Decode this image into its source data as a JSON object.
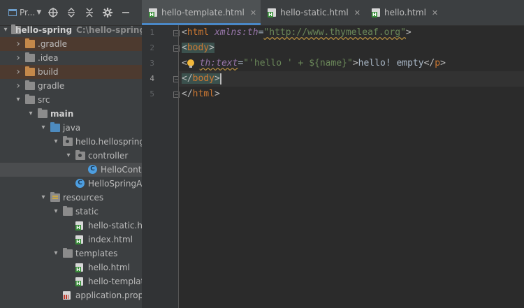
{
  "project_panel": {
    "view_label": "Pr...",
    "toolbar_icons": [
      "locate-icon",
      "expand-all-icon",
      "collapse-all-icon",
      "gear-icon",
      "hide-icon"
    ],
    "root": {
      "name": "hello-spring",
      "path": "C:\\hello-spring\\he"
    },
    "items": [
      {
        "label": ".gradle",
        "kind": "folder-orange",
        "depth": 1,
        "arrow": "closed",
        "excluded": true
      },
      {
        "label": ".idea",
        "kind": "folder",
        "depth": 1,
        "arrow": "closed"
      },
      {
        "label": "build",
        "kind": "folder-orange",
        "depth": 1,
        "arrow": "closed",
        "excluded": true
      },
      {
        "label": "gradle",
        "kind": "folder",
        "depth": 1,
        "arrow": "closed"
      },
      {
        "label": "src",
        "kind": "folder",
        "depth": 1,
        "arrow": "open"
      },
      {
        "label": "main",
        "kind": "folder",
        "depth": 2,
        "arrow": "open",
        "bold": true
      },
      {
        "label": "java",
        "kind": "folder-blue",
        "depth": 3,
        "arrow": "open"
      },
      {
        "label": "hello.hellospring",
        "kind": "package",
        "depth": 4,
        "arrow": "open"
      },
      {
        "label": "controller",
        "kind": "package",
        "depth": 5,
        "arrow": "open"
      },
      {
        "label": "HelloControlle",
        "kind": "class",
        "depth": 6,
        "selected": true
      },
      {
        "label": "HelloSpringAppli",
        "kind": "class",
        "depth": 5
      },
      {
        "label": "resources",
        "kind": "resources",
        "depth": 3,
        "arrow": "open"
      },
      {
        "label": "static",
        "kind": "folder",
        "depth": 4,
        "arrow": "open"
      },
      {
        "label": "hello-static.html",
        "kind": "html",
        "depth": 5
      },
      {
        "label": "index.html",
        "kind": "html",
        "depth": 5
      },
      {
        "label": "templates",
        "kind": "folder",
        "depth": 4,
        "arrow": "open"
      },
      {
        "label": "hello.html",
        "kind": "html",
        "depth": 5
      },
      {
        "label": "hello-template.ht",
        "kind": "html",
        "depth": 5
      },
      {
        "label": "application.propertie",
        "kind": "properties",
        "depth": 4
      }
    ]
  },
  "tabs": [
    {
      "label": "hello-template.html",
      "active": true
    },
    {
      "label": "hello-static.html",
      "active": false
    },
    {
      "label": "hello.html",
      "active": false
    }
  ],
  "editor": {
    "line_numbers": [
      "1",
      "2",
      "3",
      "4",
      "5"
    ],
    "current_line": 4,
    "lines": [
      [
        {
          "t": "<",
          "c": "bracket"
        },
        {
          "t": "html",
          "c": "tn"
        },
        {
          "t": " ",
          "c": "plain"
        },
        {
          "t": "xmlns:th",
          "c": "attr-ns"
        },
        {
          "t": "=",
          "c": "plain"
        },
        {
          "t": "\"http://www.thymeleaf.org\"",
          "c": "str wavy"
        },
        {
          "t": ">",
          "c": "bracket"
        }
      ],
      [
        {
          "t": "<",
          "c": "bracket hl-tag"
        },
        {
          "t": "body",
          "c": "tn hl-tag"
        },
        {
          "t": ">",
          "c": "bracket hl-tag"
        }
      ],
      [
        {
          "t": "<",
          "c": "bracket"
        },
        {
          "t": "BULB",
          "c": "bulb"
        },
        {
          "t": " ",
          "c": "plain"
        },
        {
          "t": "th:text",
          "c": "attr-ns wavy"
        },
        {
          "t": "=",
          "c": "plain"
        },
        {
          "t": "\"'hello ' + ${name}\"",
          "c": "str"
        },
        {
          "t": ">",
          "c": "bracket"
        },
        {
          "t": "hello! empty",
          "c": "plain"
        },
        {
          "t": "</",
          "c": "bracket"
        },
        {
          "t": "p",
          "c": "tn"
        },
        {
          "t": ">",
          "c": "bracket"
        }
      ],
      [
        {
          "t": "</",
          "c": "bracket hl-tag"
        },
        {
          "t": "body",
          "c": "tn hl-tag"
        },
        {
          "t": ">",
          "c": "bracket hl-tag"
        },
        {
          "t": "CARET",
          "c": "caret-bar"
        }
      ],
      [
        {
          "t": "</",
          "c": "bracket"
        },
        {
          "t": "html",
          "c": "tn"
        },
        {
          "t": ">",
          "c": "bracket"
        }
      ]
    ]
  }
}
